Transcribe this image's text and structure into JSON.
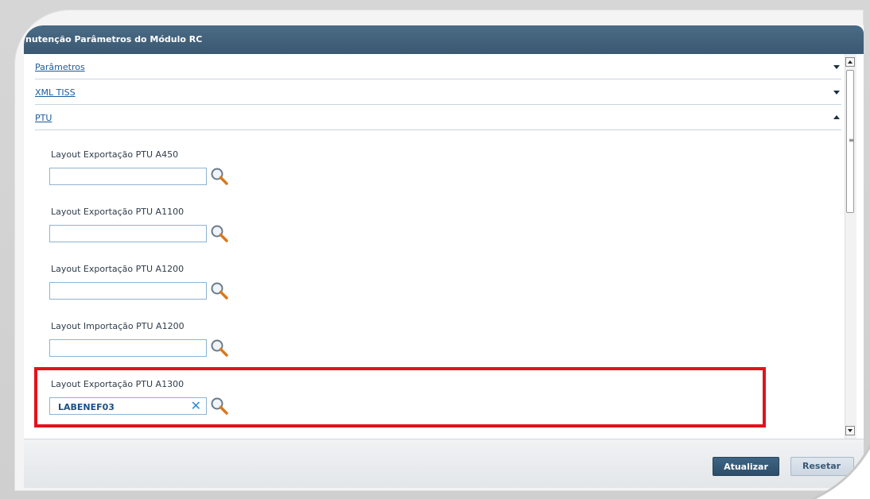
{
  "window": {
    "title": "nutenção Parâmetros do Módulo RC"
  },
  "sections": [
    {
      "label": "Parâmetros",
      "state": "collapsed"
    },
    {
      "label": "XML TISS",
      "state": "collapsed"
    },
    {
      "label": "PTU",
      "state": "expanded"
    }
  ],
  "fields": [
    {
      "label": "Layout Exportação PTU A450",
      "value": ""
    },
    {
      "label": "Layout Exportação PTU A1100",
      "value": ""
    },
    {
      "label": "Layout Exportação PTU A1200",
      "value": ""
    },
    {
      "label": "Layout Importação PTU A1200",
      "value": ""
    },
    {
      "label": "Layout Exportação PTU A1300",
      "value": "LABENEF03",
      "clear_icon": "close-icon"
    }
  ],
  "icons": {
    "search": "search-icon",
    "clear": "close-icon"
  },
  "footer": {
    "update_label": "Atualizar",
    "reset_label": "Resetar"
  },
  "colors": {
    "titlebar": "#3b5871",
    "link": "#1a5c9e",
    "highlight": "#e3121b",
    "primary_button": "#2c4d69"
  }
}
